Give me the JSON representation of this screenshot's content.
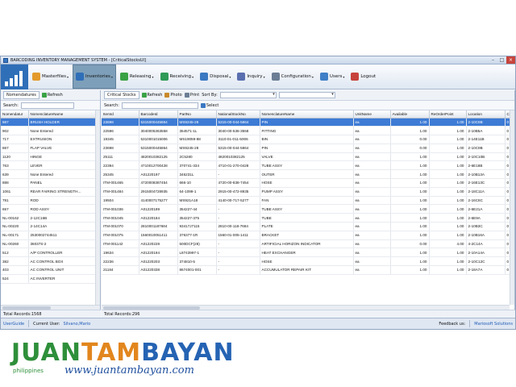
{
  "window": {
    "title": "BARCODING INVENTORY MANAGEMENT SYSTEM - [CriticalStocksUI]"
  },
  "toolbar": {
    "items": [
      {
        "label": "Masterfiles",
        "icon": "folder-icon",
        "color": "#e49a2b",
        "has_menu": true
      },
      {
        "label": "Inventories",
        "icon": "pencil-icon",
        "color": "#2f6fb8",
        "has_menu": true,
        "active": true
      },
      {
        "label": "Releasing",
        "icon": "up-arrow-icon",
        "color": "#3aa245",
        "has_menu": true
      },
      {
        "label": "Receiving",
        "icon": "down-arrow-icon",
        "color": "#2f9b57",
        "has_menu": true
      },
      {
        "label": "Disposal",
        "icon": "recycle-icon",
        "color": "#3a78c2",
        "has_menu": true
      },
      {
        "label": "Inquiry",
        "icon": "magnifier-icon",
        "color": "#5a6fb0",
        "has_menu": true
      },
      {
        "label": "Configuration",
        "icon": "wrench-icon",
        "color": "#6b7e95",
        "has_menu": true
      },
      {
        "label": "Users",
        "icon": "users-icon",
        "color": "#3f7fc7",
        "has_menu": true
      },
      {
        "label": "Logout",
        "icon": "power-icon",
        "color": "#c7433a",
        "has_menu": false
      }
    ]
  },
  "left_pane": {
    "tab": "Nomendatures",
    "refresh": "Refresh",
    "search_label": "Search:",
    "columns": [
      "Nomendatur",
      "NomenclatureName"
    ],
    "rows": [
      [
        "867",
        "BRUSH HOLDER"
      ],
      [
        "902",
        "None Entered"
      ],
      [
        "717",
        "EXTRUSION"
      ],
      [
        "867",
        "FLAP VALVE"
      ],
      [
        "1120",
        "HINGE"
      ],
      [
        "763",
        "LEVER"
      ],
      [
        "639",
        "None Entered"
      ],
      [
        "888",
        "PANEL"
      ],
      [
        "1061",
        "REAR FAIRING STRENGTH..."
      ],
      [
        "781",
        "ROD"
      ],
      [
        "657",
        "ROD ASSY"
      ],
      [
        "NL-00162",
        "2-12C16B"
      ],
      [
        "NL-00220",
        "2-14C14A"
      ],
      [
        "NL-00171",
        "2530002744511"
      ],
      [
        "NL-00260",
        "36037S-2"
      ],
      [
        "512",
        "A/P CONTROLLER"
      ],
      [
        "382",
        "AC CONTROL BOX"
      ],
      [
        "403",
        "AC CONTROL UNIT"
      ],
      [
        "524",
        "AC INVERTER"
      ]
    ],
    "total": "Total Records:1568"
  },
  "right_pane": {
    "tab": "Critical Stocks",
    "refresh": "Refresh",
    "photo": "Photo",
    "print": "Print",
    "sort_label": "Sort By:",
    "search_label": "Search:",
    "select": "Select",
    "columns": [
      "ItemId",
      "BarcodeId",
      "PartNo",
      "NationalStockNo",
      "NomenclatureName",
      "UnitName",
      "Available",
      "ReOrderPoint",
      "Location",
      "C"
    ],
    "rows": [
      [
        "23698",
        "5315000445864",
        "MS9245-28",
        "5315-00-044-5864",
        "PIN",
        "ea",
        "1.00",
        "1.00",
        "2-10C9B",
        "0"
      ],
      [
        "22596",
        "3040005363558",
        "354571-1L",
        "3040-00-536-3558",
        "FITTING",
        "ea",
        "1.00",
        "1.00",
        "2-10B5A",
        "0"
      ],
      [
        "19345",
        "5310001015006",
        "MS19059-88",
        "3110-01-011-5006",
        "BIN",
        "ea",
        "0.00",
        "1.00",
        "2-14E11B",
        "0"
      ],
      [
        "23698",
        "5315000445864",
        "MS9245-28",
        "5315-00-044-5864",
        "PIN",
        "ea",
        "0.00",
        "1.00",
        "2-10C9B",
        "0"
      ],
      [
        "25111",
        "4820010382125",
        "2C5280",
        "4820010382125",
        "VALVE",
        "ea",
        "1.00",
        "1.00",
        "2-10C10B",
        "0"
      ],
      [
        "22394",
        "4710012700428",
        "370741-334",
        "4710-01-270-0428",
        "TUBE ASSY",
        "ea",
        "1.00",
        "1.00",
        "2-6E18B",
        "0"
      ],
      [
        "25345",
        "A01220197",
        "346231L",
        "-",
        "OUTER",
        "ea",
        "1.00",
        "1.00",
        "2-10B13A",
        "0"
      ],
      [
        "ITM-001465",
        "4720008387454",
        "666-10",
        "4720-00-838-7454",
        "HOSE",
        "ea",
        "1.00",
        "1.00",
        "2-16E13C",
        "0"
      ],
      [
        "ITM-001484",
        "2915004728935",
        "64-1099-1",
        "2915-00-472-8935",
        "PUMP ASSY",
        "ea",
        "1.00",
        "1.00",
        "2-18C11A",
        "0"
      ],
      [
        "19504",
        "4140007175277",
        "MS921A18",
        "4140-00-717-5277",
        "FAN",
        "ea",
        "1.00",
        "1.00",
        "2-16C6C",
        "0"
      ],
      [
        "ITM-001036",
        "A01220189",
        "354227-44",
        "-",
        "TUBE ASSY",
        "ea",
        "1.00",
        "1.00",
        "2-6E21A",
        "0"
      ],
      [
        "ITM-001045",
        "A01220184",
        "354227-375",
        "-",
        "TUBE",
        "ea",
        "1.00",
        "1.00",
        "2-6E9A",
        "0"
      ],
      [
        "ITM-001070",
        "2810001187684",
        "93417J7115",
        "2810-00-118-7684",
        "PLATE",
        "ea",
        "1.00",
        "1.00",
        "2-10B3C",
        "0"
      ],
      [
        "ITM-001075",
        "1560010051411",
        "376377-1R",
        "1560-01-005-1411",
        "BRACKET",
        "ea",
        "1.00",
        "1.00",
        "2-10B16A",
        "0"
      ],
      [
        "ITM-001142",
        "A01220228",
        "500DCF(28)",
        "-",
        "ARTIFICIAL HORIZON INDICATOR",
        "ea",
        "0.00",
        "4.00",
        "4-2C14A",
        "0"
      ],
      [
        "19634",
        "A01220194",
        "L8743997-1",
        "-",
        "HEAT EXCHANGER",
        "ea",
        "1.00",
        "1.00",
        "2-10A14A",
        "0"
      ],
      [
        "22236",
        "A01220203",
        "374810-5",
        "-",
        "HOSE",
        "ea",
        "1.00",
        "1.00",
        "2-10C12C",
        "0"
      ],
      [
        "21184",
        "A01220338",
        "8674001-001",
        "-",
        "ACCUMULATOR REPAIR KIT",
        "ea",
        "1.00",
        "1.00",
        "2-18A7A",
        "0"
      ]
    ],
    "total": "Total Records:296"
  },
  "statusbar": {
    "user_guide": "UserGuide",
    "current_user_label": "Current User:",
    "current_user": "Silvano,Mario",
    "feedback_label": "Feedback us:",
    "company": "Mariosoft Solutions"
  },
  "watermark": {
    "brand": [
      "JUAN",
      "TAM",
      "BAYAN"
    ],
    "tagline": "philippines",
    "url": "www.juantambayan.com"
  }
}
